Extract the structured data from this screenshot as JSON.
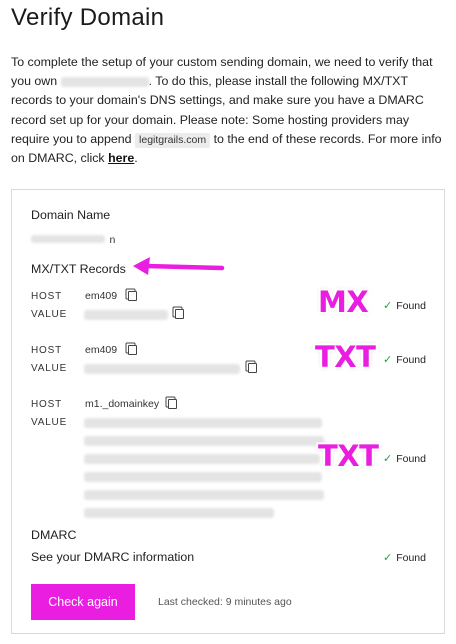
{
  "page": {
    "title": "Verify Domain",
    "intro": {
      "part1": "To complete the setup of your custom sending domain, we need to verify that you own",
      "part2": ". To do this, please install the following MX/TXT records to your domain's DNS settings, and make sure you have a DMARC record set up for your domain. Please note: Some hosting providers may require you to append",
      "code": "legitgrails.com",
      "part3": "to the end of these records. For more info on DMARC, click",
      "link": "here",
      "part4": "."
    }
  },
  "card": {
    "domain_name_label": "Domain Name",
    "domain_name_suffix": "n",
    "records_label": "MX/TXT Records",
    "records": [
      {
        "host_label": "HOST",
        "host_value": "em409",
        "value_label": "VALUE",
        "status": "Found",
        "tag": "MX"
      },
      {
        "host_label": "HOST",
        "host_value": "em409",
        "value_label": "VALUE",
        "status": "Found",
        "tag": "TXT"
      },
      {
        "host_label": "HOST",
        "host_value": "m1._domainkey",
        "value_label": "VALUE",
        "status": "Found",
        "tag": "TXT"
      }
    ],
    "dmarc_label": "DMARC",
    "dmarc_info": "See your DMARC information",
    "dmarc_status": "Found",
    "check_again": "Check again",
    "last_checked": "Last checked: 9 minutes ago"
  },
  "colors": {
    "accent": "#e91ee0",
    "success": "#1e9e4a",
    "border": "#d9d9d9"
  },
  "icons": [
    "copy-icon",
    "check-icon",
    "arrow-left-icon"
  ]
}
